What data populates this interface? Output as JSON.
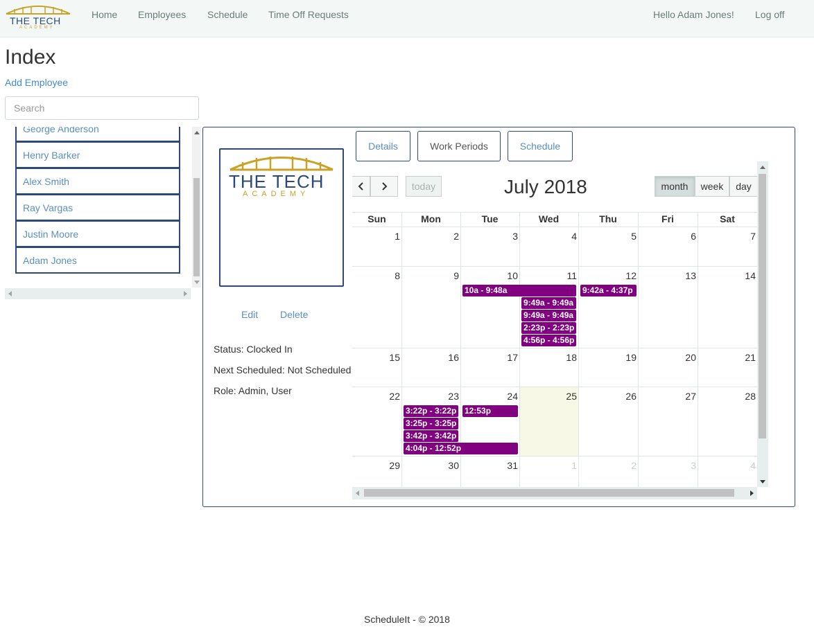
{
  "brand": {
    "line1": "THE TECH",
    "line2": "ACADEMY",
    "colors": {
      "navy": "#2b4a7a",
      "gold": "#c9a227"
    }
  },
  "nav": {
    "items": [
      "Home",
      "Employees",
      "Schedule",
      "Time Off Requests"
    ],
    "greeting": "Hello Adam Jones!",
    "logoff": "Log off"
  },
  "page": {
    "title": "Index",
    "add_employee": "Add Employee",
    "search_placeholder": "Search"
  },
  "employees": [
    "George Anderson",
    "Henry Barker",
    "Alex Smith",
    "Ray Vargas",
    "Justin Moore",
    "Adam Jones"
  ],
  "detail": {
    "photo_line1": "THE TECH",
    "photo_line2": "ACADEMY",
    "edit": "Edit",
    "delete": "Delete",
    "status": "Status: Clocked In",
    "next_scheduled": "Next Scheduled: Not Scheduled",
    "role": "Role: Admin, User",
    "tabs": [
      "Details",
      "Work Periods",
      "Schedule"
    ]
  },
  "calendar": {
    "title": "July 2018",
    "today_label": "today",
    "prev_icon": "chevron-left-icon",
    "next_icon": "chevron-right-icon",
    "views": [
      "month",
      "week",
      "day"
    ],
    "active_view": "month",
    "weekdays": [
      "Sun",
      "Mon",
      "Tue",
      "Wed",
      "Thu",
      "Fri",
      "Sat"
    ],
    "weeks": [
      [
        "1",
        "2",
        "3",
        "4",
        "5",
        "6",
        "7"
      ],
      [
        "8",
        "9",
        "10",
        "11",
        "12",
        "13",
        "14"
      ],
      [
        "15",
        "16",
        "17",
        "18",
        "19",
        "20",
        "21"
      ],
      [
        "22",
        "23",
        "24",
        "25",
        "26",
        "27",
        "28"
      ],
      [
        "29",
        "30",
        "31",
        "1",
        "2",
        "3",
        "4"
      ]
    ],
    "today_date": "25",
    "event_color": "#800080",
    "events": [
      {
        "label": "10a - 9:48a",
        "start": "2018-07-10",
        "end": "2018-07-11"
      },
      {
        "label": "9:42a - 4:37p",
        "start": "2018-07-12",
        "end": "2018-07-12"
      },
      {
        "label": "9:49a - 9:49a",
        "start": "2018-07-11",
        "end": "2018-07-11"
      },
      {
        "label": "9:49a - 9:49a",
        "start": "2018-07-11",
        "end": "2018-07-11"
      },
      {
        "label": "2:23p - 2:23p",
        "start": "2018-07-11",
        "end": "2018-07-11"
      },
      {
        "label": "4:56p - 4:56p",
        "start": "2018-07-11",
        "end": "2018-07-11"
      },
      {
        "label": "3:22p - 3:22p",
        "start": "2018-07-23",
        "end": "2018-07-23"
      },
      {
        "label": "12:53p",
        "start": "2018-07-24",
        "end": "2018-07-24"
      },
      {
        "label": "3:25p - 3:25p",
        "start": "2018-07-23",
        "end": "2018-07-23"
      },
      {
        "label": "3:42p - 3:42p",
        "start": "2018-07-23",
        "end": "2018-07-23"
      },
      {
        "label": "4:04p - 12:52p",
        "start": "2018-07-23",
        "end": "2018-07-24"
      }
    ]
  },
  "footer": "ScheduleIt - © 2018"
}
